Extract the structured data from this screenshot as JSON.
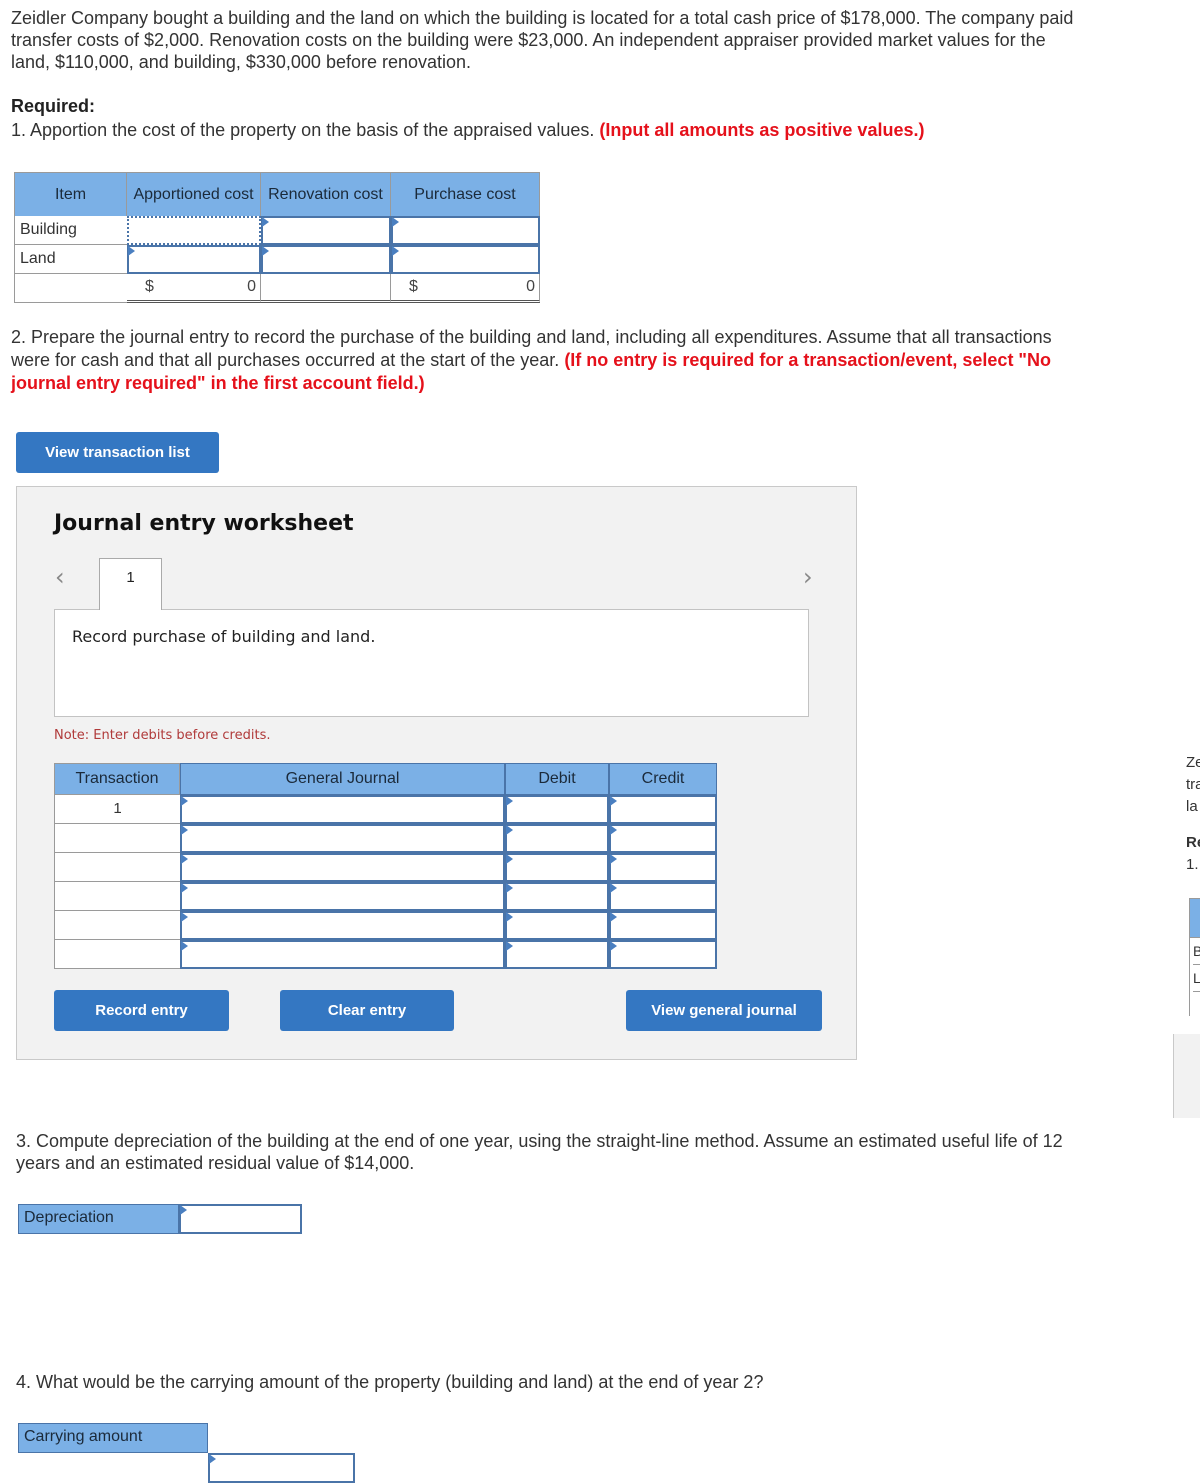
{
  "problem": {
    "intro_line1": "Zeidler Company bought a building and the land on which the building is located for a total cash price of $178,000. The company paid",
    "intro_line2": "transfer costs of $2,000. Renovation costs on the building were $23,000. An independent appraiser provided market values for the",
    "intro_line3": "land, $110,000, and building, $330,000 before renovation.",
    "required_label": "Required:",
    "q1_text": "1. Apportion the cost of the property on the basis of the appraised values.",
    "q1_instruction": "(Input all amounts as positive values.)"
  },
  "apportion_table": {
    "headers": [
      "Item",
      "Apportioned cost",
      "Renovation cost",
      "Purchase cost"
    ],
    "rows": [
      {
        "item": "Building",
        "apportioned": "",
        "renovation": "",
        "purchase": ""
      },
      {
        "item": "Land",
        "apportioned": "",
        "renovation": "",
        "purchase": ""
      }
    ],
    "total": {
      "currency": "$",
      "apportioned": "0",
      "purchase": "0"
    }
  },
  "q2": {
    "line1": "2. Prepare the journal entry to record the purchase of the building and land, including all expenditures. Assume that all transactions",
    "line2": "were for cash and that all purchases occurred at the start of the year.",
    "instruction_a": "(If no entry is required for a transaction/event, select \"No",
    "instruction_b": "journal entry required\" in the first account field.)"
  },
  "view_transaction_list_label": "View transaction list",
  "worksheet": {
    "title": "Journal entry worksheet",
    "prev_icon": "‹",
    "next_icon": "›",
    "active_tab": "1",
    "description": "Record purchase of building and land.",
    "note": "Note: Enter debits before credits.",
    "headers": [
      "Transaction",
      "General Journal",
      "Debit",
      "Credit"
    ],
    "rows": [
      {
        "transaction": "1",
        "account": "",
        "debit": "",
        "credit": ""
      },
      {
        "transaction": "",
        "account": "",
        "debit": "",
        "credit": ""
      },
      {
        "transaction": "",
        "account": "",
        "debit": "",
        "credit": ""
      },
      {
        "transaction": "",
        "account": "",
        "debit": "",
        "credit": ""
      },
      {
        "transaction": "",
        "account": "",
        "debit": "",
        "credit": ""
      },
      {
        "transaction": "",
        "account": "",
        "debit": "",
        "credit": ""
      }
    ],
    "buttons": {
      "record": "Record entry",
      "clear": "Clear entry",
      "view_journal": "View general journal"
    }
  },
  "q3": {
    "line1": "3. Compute depreciation of the building at the end of one year, using the straight-line method. Assume an estimated useful life of 12",
    "line2": "years and an estimated residual value of $14,000.",
    "field_label": "Depreciation",
    "field_value": ""
  },
  "q4": {
    "text": "4. What would be the carrying amount of the property (building and land) at the end of year 2?",
    "field_label": "Carrying amount",
    "field_value": ""
  },
  "clipped_overlay": {
    "line1": "Ze",
    "line2": "tra",
    "line3": "la",
    "req": "Re",
    "q": "1.",
    "row1": "B",
    "row2": "L"
  },
  "colors": {
    "header_blue": "#7bb0e6",
    "button_blue": "#3477c2",
    "instruction_red": "#e5111b",
    "input_border": "#4a74a8"
  }
}
